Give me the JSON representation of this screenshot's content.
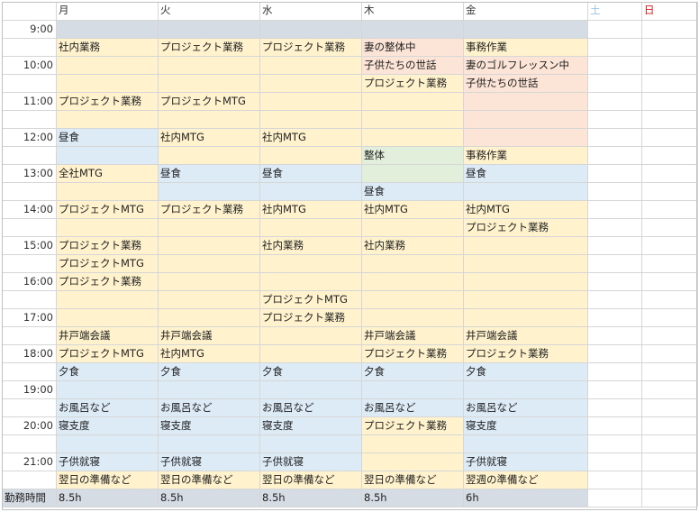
{
  "days": [
    {
      "label": "月"
    },
    {
      "label": "火"
    },
    {
      "label": "水"
    },
    {
      "label": "木"
    },
    {
      "label": "金"
    },
    {
      "label": "土",
      "color": "#9dc3e6"
    },
    {
      "label": "日",
      "color": "#e01b1b"
    }
  ],
  "times": [
    "9:00",
    "10:00",
    "11:00",
    "12:00",
    "13:00",
    "14:00",
    "15:00",
    "16:00",
    "17:00",
    "18:00",
    "19:00",
    "20:00",
    "21:00"
  ],
  "colors": {
    "work": "#fff2cc",
    "meal": "#ddebf7",
    "wife": "#fce4d6",
    "green": "#e2efda",
    "header_band": "#d6dce4",
    "footer_band": "#d6dce4"
  },
  "events": [
    {
      "day": 0,
      "start": 2,
      "end": 5,
      "type": "work",
      "label": "社内業務"
    },
    {
      "day": 0,
      "start": 5,
      "end": 7,
      "type": "work",
      "label": "プロジェクト業務"
    },
    {
      "day": 0,
      "start": 7,
      "end": 9,
      "type": "meal",
      "label": "昼食"
    },
    {
      "day": 0,
      "start": 9,
      "end": 11,
      "type": "work",
      "label": "全社MTG"
    },
    {
      "day": 0,
      "start": 11,
      "end": 13,
      "type": "work",
      "label": "プロジェクトMTG"
    },
    {
      "day": 0,
      "start": 13,
      "end": 14,
      "type": "work",
      "label": "プロジェクト業務"
    },
    {
      "day": 0,
      "start": 14,
      "end": 15,
      "type": "work",
      "label": "プロジェクトMTG"
    },
    {
      "day": 0,
      "start": 15,
      "end": 18,
      "type": "work",
      "label": "プロジェクト業務"
    },
    {
      "day": 0,
      "start": 18,
      "end": 19,
      "type": "work",
      "label": "井戸端会議"
    },
    {
      "day": 0,
      "start": 19,
      "end": 20,
      "type": "work",
      "label": "プロジェクトMTG"
    },
    {
      "day": 0,
      "start": 20,
      "end": 22,
      "type": "meal",
      "label": "夕食"
    },
    {
      "day": 0,
      "start": 22,
      "end": 23,
      "type": "meal",
      "label": "お風呂など"
    },
    {
      "day": 0,
      "start": 23,
      "end": 25,
      "type": "meal",
      "label": "寝支度"
    },
    {
      "day": 0,
      "start": 25,
      "end": 26,
      "type": "meal",
      "label": "子供就寝"
    },
    {
      "day": 0,
      "start": 26,
      "end": 27,
      "type": "work",
      "label": "翌日の準備など"
    },
    {
      "day": 1,
      "start": 2,
      "end": 5,
      "type": "work",
      "label": "プロジェクト業務"
    },
    {
      "day": 1,
      "start": 5,
      "end": 7,
      "type": "work",
      "label": "プロジェクトMTG"
    },
    {
      "day": 1,
      "start": 7,
      "end": 9,
      "type": "work",
      "label": "社内MTG"
    },
    {
      "day": 1,
      "start": 9,
      "end": 11,
      "type": "meal",
      "label": "昼食"
    },
    {
      "day": 1,
      "start": 11,
      "end": 18,
      "type": "work",
      "label": "プロジェクト業務"
    },
    {
      "day": 1,
      "start": 18,
      "end": 19,
      "type": "work",
      "label": "井戸端会議"
    },
    {
      "day": 1,
      "start": 19,
      "end": 20,
      "type": "work",
      "label": "社内MTG"
    },
    {
      "day": 1,
      "start": 20,
      "end": 22,
      "type": "meal",
      "label": "夕食"
    },
    {
      "day": 1,
      "start": 22,
      "end": 23,
      "type": "meal",
      "label": "お風呂など"
    },
    {
      "day": 1,
      "start": 23,
      "end": 25,
      "type": "meal",
      "label": "寝支度"
    },
    {
      "day": 1,
      "start": 25,
      "end": 26,
      "type": "meal",
      "label": "子供就寝"
    },
    {
      "day": 1,
      "start": 26,
      "end": 27,
      "type": "work",
      "label": "翌日の準備など"
    },
    {
      "day": 2,
      "start": 2,
      "end": 7,
      "type": "work",
      "label": "プロジェクト業務"
    },
    {
      "day": 2,
      "start": 7,
      "end": 9,
      "type": "work",
      "label": "社内MTG"
    },
    {
      "day": 2,
      "start": 9,
      "end": 11,
      "type": "meal",
      "label": "昼食"
    },
    {
      "day": 2,
      "start": 11,
      "end": 13,
      "type": "work",
      "label": "社内MTG"
    },
    {
      "day": 2,
      "start": 13,
      "end": 16,
      "type": "work",
      "label": "社内業務"
    },
    {
      "day": 2,
      "start": 16,
      "end": 17,
      "type": "work",
      "label": "プロジェクトMTG"
    },
    {
      "day": 2,
      "start": 17,
      "end": 20,
      "type": "work",
      "label": "プロジェクト業務"
    },
    {
      "day": 2,
      "start": 20,
      "end": 22,
      "type": "meal",
      "label": "夕食"
    },
    {
      "day": 2,
      "start": 22,
      "end": 23,
      "type": "meal",
      "label": "お風呂など"
    },
    {
      "day": 2,
      "start": 23,
      "end": 25,
      "type": "meal",
      "label": "寝支度"
    },
    {
      "day": 2,
      "start": 25,
      "end": 26,
      "type": "meal",
      "label": "子供就寝"
    },
    {
      "day": 2,
      "start": 26,
      "end": 27,
      "type": "work",
      "label": "翌日の準備など"
    },
    {
      "day": 3,
      "start": 2,
      "end": 3,
      "type": "wife",
      "label": "妻の整体中"
    },
    {
      "day": 3,
      "start": 3,
      "end": 4,
      "type": "wife",
      "label": "子供たちの世話"
    },
    {
      "day": 3,
      "start": 4,
      "end": 8,
      "type": "work",
      "label": "プロジェクト業務"
    },
    {
      "day": 3,
      "start": 8,
      "end": 10,
      "type": "green",
      "label": "整体"
    },
    {
      "day": 3,
      "start": 10,
      "end": 11,
      "type": "meal",
      "label": "昼食"
    },
    {
      "day": 3,
      "start": 11,
      "end": 13,
      "type": "work",
      "label": "社内MTG"
    },
    {
      "day": 3,
      "start": 13,
      "end": 18,
      "type": "work",
      "label": "社内業務"
    },
    {
      "day": 3,
      "start": 18,
      "end": 19,
      "type": "work",
      "label": "井戸端会議"
    },
    {
      "day": 3,
      "start": 19,
      "end": 20,
      "type": "work",
      "label": "プロジェクト業務"
    },
    {
      "day": 3,
      "start": 20,
      "end": 22,
      "type": "meal",
      "label": "夕食"
    },
    {
      "day": 3,
      "start": 22,
      "end": 23,
      "type": "meal",
      "label": "お風呂など"
    },
    {
      "day": 3,
      "start": 23,
      "end": 26,
      "type": "work",
      "label": "プロジェクト業務"
    },
    {
      "day": 3,
      "start": 26,
      "end": 27,
      "type": "work",
      "label": "翌日の準備など"
    },
    {
      "day": 4,
      "start": 2,
      "end": 3,
      "type": "work",
      "label": "事務作業"
    },
    {
      "day": 4,
      "start": 3,
      "end": 4,
      "type": "wife",
      "label": "妻のゴルフレッスン中"
    },
    {
      "day": 4,
      "start": 4,
      "end": 8,
      "type": "wife",
      "label": "子供たちの世話"
    },
    {
      "day": 4,
      "start": 8,
      "end": 9,
      "type": "work",
      "label": "事務作業"
    },
    {
      "day": 4,
      "start": 9,
      "end": 11,
      "type": "meal",
      "label": "昼食"
    },
    {
      "day": 4,
      "start": 11,
      "end": 12,
      "type": "work",
      "label": "社内MTG"
    },
    {
      "day": 4,
      "start": 12,
      "end": 18,
      "type": "work",
      "label": "プロジェクト業務"
    },
    {
      "day": 4,
      "start": 18,
      "end": 19,
      "type": "work",
      "label": "井戸端会議"
    },
    {
      "day": 4,
      "start": 19,
      "end": 20,
      "type": "work",
      "label": "プロジェクト業務"
    },
    {
      "day": 4,
      "start": 20,
      "end": 22,
      "type": "meal",
      "label": "夕食"
    },
    {
      "day": 4,
      "start": 22,
      "end": 23,
      "type": "meal",
      "label": "お風呂など"
    },
    {
      "day": 4,
      "start": 23,
      "end": 25,
      "type": "meal",
      "label": "寝支度"
    },
    {
      "day": 4,
      "start": 25,
      "end": 26,
      "type": "meal",
      "label": "子供就寝"
    },
    {
      "day": 4,
      "start": 26,
      "end": 27,
      "type": "work",
      "label": "翌週の準備など"
    }
  ],
  "footer": {
    "label": "勤務時間",
    "values": [
      "8.5h",
      "8.5h",
      "8.5h",
      "8.5h",
      "6h",
      "",
      ""
    ]
  }
}
